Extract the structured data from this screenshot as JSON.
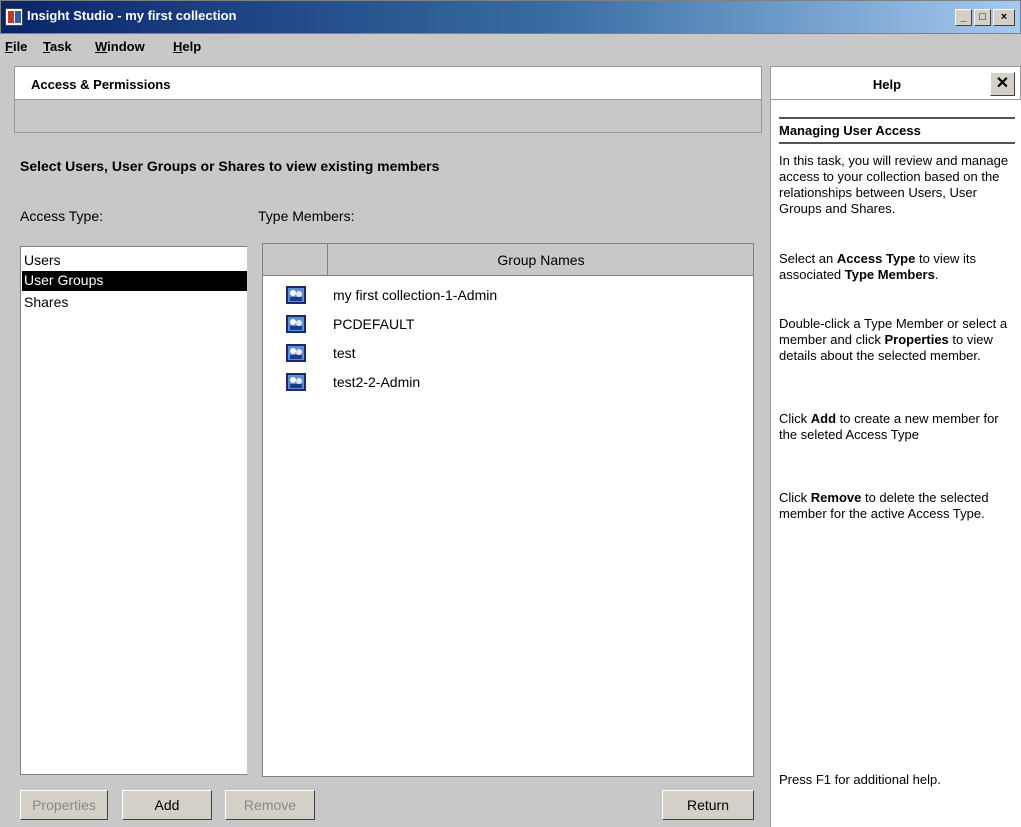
{
  "window": {
    "title": "Insight Studio - my first collection",
    "minimize": "_",
    "maximize": "□",
    "close": "×"
  },
  "menu": {
    "file": {
      "u": "F",
      "rest": "ile"
    },
    "task": {
      "u": "T",
      "rest": "ask"
    },
    "window": {
      "u": "W",
      "rest": "indow"
    },
    "help": {
      "u": "H",
      "rest": "elp"
    }
  },
  "section_title": "Access & Permissions",
  "instruction": "Select Users, User Groups or Shares to view existing members",
  "access_type_label": "Access Type:",
  "type_members_label": "Type Members:",
  "access_types": [
    "Users",
    "User Groups",
    "Shares"
  ],
  "selected_access_type": "User Groups",
  "members_column_header": "Group Names",
  "members": [
    "my first collection-1-Admin",
    "PCDEFAULT",
    "test",
    "test2-2-Admin"
  ],
  "buttons": {
    "properties": "Properties",
    "add": "Add",
    "remove": "Remove",
    "return": "Return"
  },
  "help": {
    "title": "Help",
    "close": "✕",
    "topic": "Managing User Access",
    "p1": "In this task, you will review and manage access to your collection based on the relationships between Users, User Groups and Shares.",
    "p2_a": "Select an ",
    "p2_b": "Access Type",
    "p2_c": " to view its associated ",
    "p2_d": "Type Members",
    "p2_e": ".",
    "p3_a": "Double-click a Type Member or select a member and click ",
    "p3_b": "Properties",
    "p3_c": " to view details about the selected member.",
    "p4_a": "Click ",
    "p4_b": "Add",
    "p4_c": " to create a new member for the seleted Access Type",
    "p5_a": "Click ",
    "p5_b": "Remove",
    "p5_c": " to delete the selected member for the active Access Type.",
    "footer": "Press F1 for additional help."
  }
}
